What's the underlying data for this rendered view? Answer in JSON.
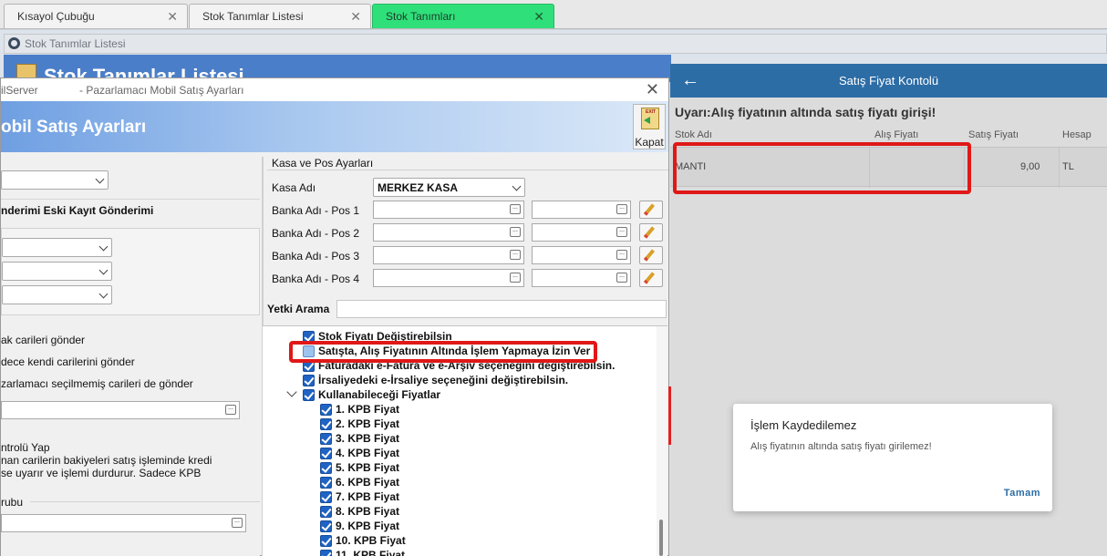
{
  "tabs": [
    {
      "label": "Kısayol Çubuğu"
    },
    {
      "label": "Stok Tanımlar Listesi"
    },
    {
      "label": "Stok Tanımları"
    }
  ],
  "background_window": {
    "title": "Stok Tanımlar Listesi",
    "header_text": "Stok Tanımlar Listesi"
  },
  "dialog": {
    "title_left": "ilServer",
    "title_right": "- Pazarlamacı Mobil Satış Ayarları",
    "banner_title": "obil Satış Ayarları",
    "kapat_label": "Kapat",
    "left": {
      "tabs_row": "nderimi  Eski Kayıt Gönderimi",
      "labels": [
        "ak carileri gönder",
        "dece kendi carilerini gönder",
        "zarlamacı seçilmemiş carileri de gönder",
        "ntrolü Yap",
        "nan carilerin bakiyeleri satış işleminde kredi",
        "se uyarır ve işlemi durdurur. Sadece KPB",
        "rubu"
      ]
    },
    "kasa_pos": {
      "section_title": "Kasa ve Pos Ayarları",
      "kasa_label": "Kasa Adı",
      "kasa_value": "MERKEZ KASA",
      "bank_labels": [
        "Banka Adı - Pos 1",
        "Banka Adı - Pos 2",
        "Banka Adı - Pos 3",
        "Banka Adı - Pos 4"
      ],
      "yetki_label": "Yetki Arama"
    },
    "tree": {
      "items": [
        {
          "label": "Stok Fiyatı Değiştirebilsin",
          "checked": true
        },
        {
          "label": "Satışta, Alış Fiyatının Altında İşlem Yapmaya İzin Ver",
          "checked": false
        },
        {
          "label": "Faturadaki e-Fatura ve e-Arşiv  seçeneğini değiştirebilsin.",
          "checked": true
        },
        {
          "label": "İrsaliyedeki e-İrsaliye seçeneğini değiştirebilsin.",
          "checked": true
        },
        {
          "label": "Kullanabileceği Fiyatlar",
          "checked": true
        },
        {
          "label": "1.  KPB Fiyat",
          "checked": true
        },
        {
          "label": "2.  KPB Fiyat",
          "checked": true
        },
        {
          "label": "3.  KPB Fiyat",
          "checked": true
        },
        {
          "label": "4.  KPB Fiyat",
          "checked": true
        },
        {
          "label": "5.  KPB Fiyat",
          "checked": true
        },
        {
          "label": "6.  KPB Fiyat",
          "checked": true
        },
        {
          "label": "7.  KPB Fiyat",
          "checked": true
        },
        {
          "label": "8.  KPB Fiyat",
          "checked": true
        },
        {
          "label": "9.  KPB Fiyat",
          "checked": true
        },
        {
          "label": "10.  KPB Fiyat",
          "checked": true
        },
        {
          "label": "11.  KPB Fiyat",
          "checked": true
        }
      ]
    }
  },
  "mobile": {
    "title": "Satış Fiyat Kontolü",
    "warning": "Uyarı:Alış fiyatının altında satış fiyatı girişi!",
    "columns": [
      "Stok Adı",
      "Alış Fiyatı",
      "Satış Fiyatı",
      "Hesap"
    ],
    "row": {
      "stok_adi": "MANTI",
      "alis_fiyati": "",
      "satis_fiyati": "9,00",
      "hesap": "TL"
    },
    "alert": {
      "title": "İşlem Kaydedilemez",
      "message": "Alış fiyatının altında satış fiyatı girilemez!",
      "button": "Tamam"
    }
  },
  "colors": {
    "active_tab": "#2fe07a",
    "app_bar": "#2d6da6",
    "highlight_red": "#e01818",
    "checkbox_blue": "#1f63c4"
  }
}
